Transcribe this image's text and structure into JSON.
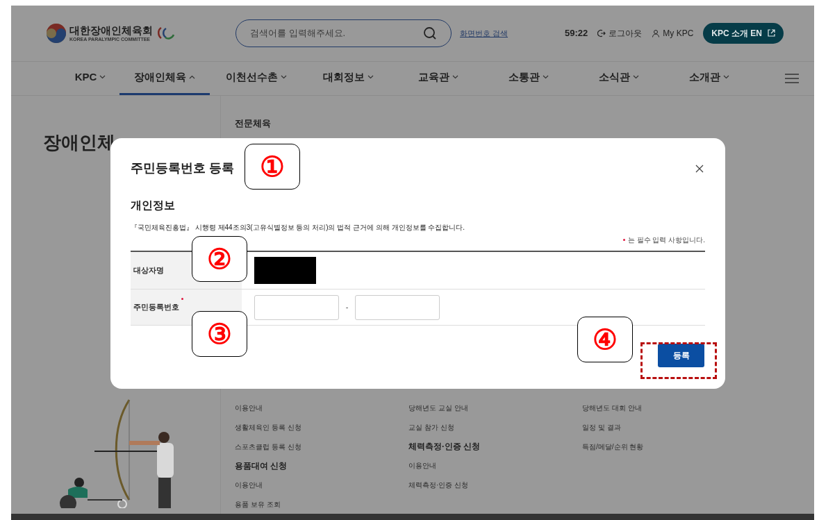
{
  "header": {
    "logo": {
      "title": "대한장애인체육회",
      "subtitle": "KOREA PARALYMPIC COMMITTEE"
    },
    "search": {
      "placeholder": "검색어를 입력해주세요."
    },
    "screen_search_link": "화면번호 검색",
    "timer": "59:22",
    "logout": "로그아웃",
    "my_page": "My KPC",
    "intro_button": "KPC 소개 EN"
  },
  "nav": {
    "items": [
      {
        "label": "KPC",
        "expanded": false
      },
      {
        "label": "장애인체육",
        "expanded": true
      },
      {
        "label": "이천선수촌",
        "expanded": false
      },
      {
        "label": "대회정보",
        "expanded": false
      },
      {
        "label": "교육관",
        "expanded": false
      },
      {
        "label": "소통관",
        "expanded": false
      },
      {
        "label": "소식관",
        "expanded": false
      },
      {
        "label": "소개관",
        "expanded": false
      }
    ]
  },
  "page_title": "장애인체",
  "menu": {
    "section_title": "전문체육",
    "columns": [
      {
        "blocks": [
          {
            "items": [
              "이용안내",
              "생활체육인 등록 신청",
              "스포츠클럽 등록 신청"
            ]
          },
          {
            "heading": "용품대여 신청",
            "items": [
              "이용안내",
              "용품 보유 조회"
            ]
          }
        ]
      },
      {
        "blocks": [
          {
            "items": [
              "당해년도 교실 안내",
              "교실 참가 신청"
            ]
          },
          {
            "heading": "체력측정·인증 신청",
            "items": [
              "이용안내",
              "체력측정·인증 신청"
            ]
          }
        ]
      },
      {
        "blocks": [
          {
            "items": [
              "당해년도 대회 안내",
              "일정 및 결과",
              "득점/메달/순위 현황"
            ]
          }
        ]
      }
    ]
  },
  "modal": {
    "title": "주민등록번호 등록",
    "section_title": "개인정보",
    "notice": "『국민체육진흥법』 시행령 제44조의3(고유식별정보 등의 처리)의 법적 근거에 의해 개인정보를 수집합니다.",
    "required_note": "는 필수 입력 사항입니다.",
    "rows": [
      {
        "label": "대상자명",
        "required": false,
        "kind": "redacted"
      },
      {
        "label": "주민등록번호",
        "required": true,
        "kind": "ssn",
        "separator": "-"
      }
    ],
    "submit": {
      "label": "등록",
      "highlighted": true
    }
  },
  "annotations": [
    {
      "label": "①"
    },
    {
      "label": "②"
    },
    {
      "label": "③"
    },
    {
      "label": "④"
    }
  ]
}
